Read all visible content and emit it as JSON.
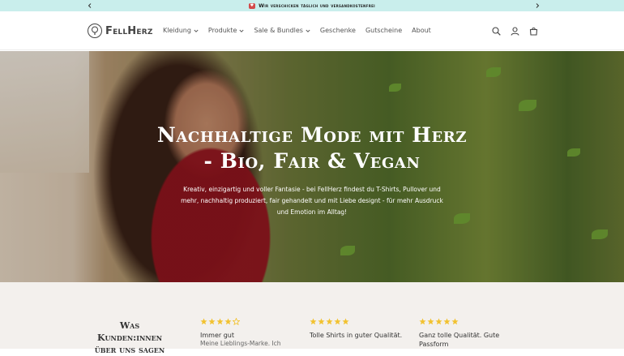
{
  "announcement": {
    "message": "Wir verschicken täglich und versandkostenfrei",
    "prev_icon": "chevron-left-icon",
    "next_icon": "chevron-right-icon"
  },
  "header": {
    "logo_text": "FellHerz",
    "nav": [
      {
        "label": "Kleidung",
        "has_dropdown": true
      },
      {
        "label": "Produkte",
        "has_dropdown": true
      },
      {
        "label": "Sale & Bundles",
        "has_dropdown": true
      },
      {
        "label": "Geschenke",
        "has_dropdown": false
      },
      {
        "label": "Gutscheine",
        "has_dropdown": false
      },
      {
        "label": "About",
        "has_dropdown": false
      }
    ],
    "icons": [
      "search-icon",
      "account-icon",
      "cart-icon"
    ]
  },
  "hero": {
    "title_line1": "Nachhaltige Mode mit Herz",
    "title_line2": "- Bio, Fair & Vegan",
    "subtitle": "Kreativ, einzigartig und voller Fantasie - bei FellHerz findest du T-Shirts, Pullover und mehr, nachhaltig produziert, fair gehandelt und mit Liebe designt - für mehr Ausdruck und Emotion im Alltag!"
  },
  "reviews": {
    "heading": "Was Kunden:innen über uns sagen",
    "items": [
      {
        "rating": 4,
        "title": "Immer gut",
        "text": "Meine Lieblings-Marke. Ich"
      },
      {
        "rating": 5,
        "title": "Tolle Shirts in guter Qualität.",
        "text": ""
      },
      {
        "rating": 5,
        "title": "Ganz tolle Qualität. Gute Passform",
        "text": ""
      }
    ]
  },
  "colors": {
    "announcement_bg": "#c9eeec",
    "star": "#f2c230",
    "reviews_bg": "#f3f0ed"
  }
}
